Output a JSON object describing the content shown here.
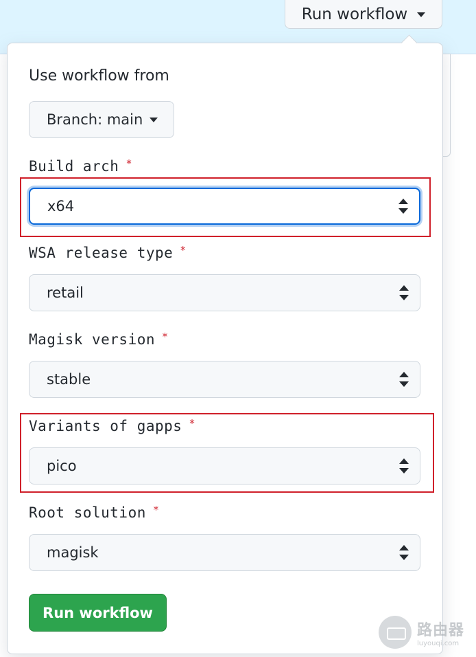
{
  "header": {
    "run_workflow_label": "Run workflow"
  },
  "dropdown": {
    "use_label": "Use workflow from",
    "branch_button": "Branch: main",
    "required_mark": "*",
    "fields": [
      {
        "label": "Build arch",
        "value": "x64"
      },
      {
        "label": "WSA release type",
        "value": "retail"
      },
      {
        "label": "Magisk version",
        "value": "stable"
      },
      {
        "label": "Variants of gapps",
        "value": "pico"
      },
      {
        "label": "Root solution",
        "value": "magisk"
      }
    ],
    "submit_label": "Run workflow"
  },
  "watermark": {
    "text_cn": "路由器",
    "text_url": "luyouqi.com"
  },
  "colors": {
    "accent": "#0969da",
    "success": "#2da44e",
    "highlight": "#d0202a",
    "required": "#cf222e"
  },
  "icons": [
    "caret-down-icon",
    "select-arrows-icon",
    "router-logo-icon"
  ]
}
